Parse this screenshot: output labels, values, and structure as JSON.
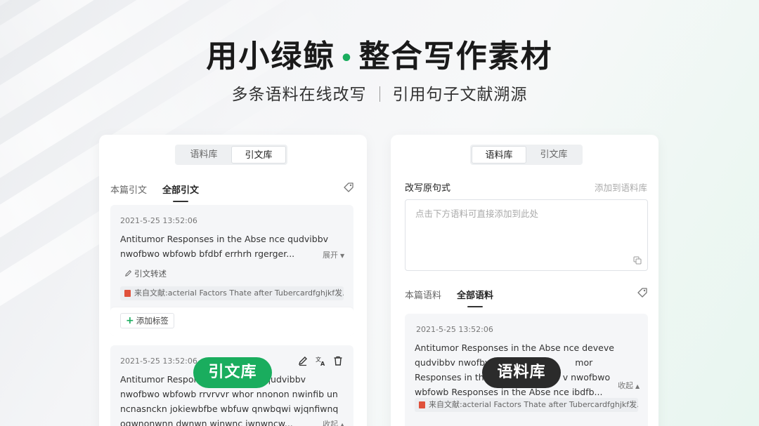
{
  "hero": {
    "title_a": "用小绿鲸",
    "title_dot": "•",
    "title_b": "整合写作素材",
    "sub_a": "多条语料在线改写",
    "sub_b": "引用句子文献溯源"
  },
  "left_card": {
    "seg_tabs": [
      {
        "label": "语料库",
        "active": false
      },
      {
        "label": "引文库",
        "active": true
      }
    ],
    "sub_tabs": [
      {
        "label": "本篇引文",
        "active": false
      },
      {
        "label": "全部引文",
        "active": true
      }
    ],
    "items": [
      {
        "time": "2021-5-25 13:52:06",
        "lines": [
          "Antitumor Responses in the Abse nce qudvibbv",
          "nwofbwo wbfowb bfdbf errhrh rgerger..."
        ],
        "toggle": "展开",
        "rewrite": "引文转述",
        "source": "来自文献:acterial Factors Thate after Tubercardfghjkf发...",
        "add_tag": "添加标签"
      },
      {
        "time": "2021-5-25 13:52:06",
        "lines": [
          "Antitumor Respon",
          "nwofbwo wbfowb rrvrvvr whor nnonon nwinfib un",
          "ncnasnckn jokiewbfbe wbfuw qnwbqwi wjqnfiwnq",
          "oqwnonwnn dwnwn wjnwnc jwnwncw..."
        ],
        "line1_tail": "e qudvibbv",
        "toggle": "收起"
      }
    ],
    "pill": "引文库"
  },
  "right_card": {
    "seg_tabs": [
      {
        "label": "语料库",
        "active": true
      },
      {
        "label": "引文库",
        "active": false
      }
    ],
    "rewrite_label": "改写原句式",
    "add_link": "添加到语料库",
    "placeholder": "点击下方语料可直接添加到此处",
    "sub_tabs": [
      {
        "label": "本篇语料",
        "active": false
      },
      {
        "label": "全部语料",
        "active": true
      }
    ],
    "item": {
      "time": "2021-5-25 13:52:06",
      "line1": "Antitumor Responses in the Abse nce deveve",
      "line2": "qudvibbv nwofbw",
      "line2_tail": "mor",
      "line3": "Responses in th",
      "line3_tail": "v nwofbwo",
      "line4": "wbfowb Responses in the Abse nce ibdfb...",
      "toggle": "收起",
      "source": "来自文献:acterial Factors Thate after Tubercardfghjkf发..."
    },
    "pill": "语料库"
  },
  "colors": {
    "accent": "#1aad5e",
    "dark_pill": "#2b2b2b",
    "pdf_red": "#e0513b"
  }
}
